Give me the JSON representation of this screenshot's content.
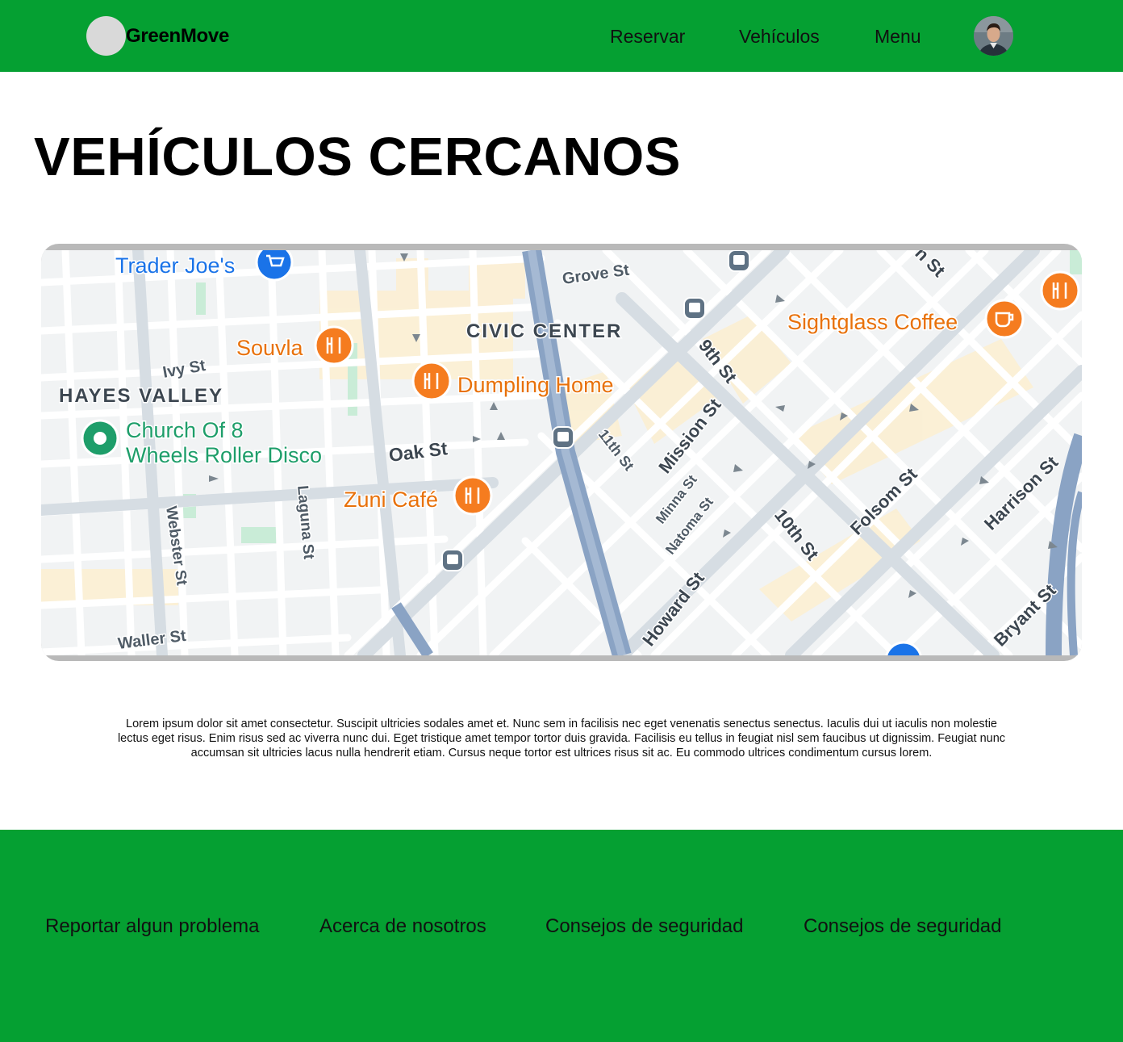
{
  "header": {
    "brand": "GreenMove",
    "nav": [
      {
        "label": "Reservar"
      },
      {
        "label": "Vehículos"
      },
      {
        "label": "Menu"
      }
    ],
    "bg_color": "#05a032"
  },
  "main": {
    "title": "VEHÍCULOS CERCANOS",
    "map": {
      "districts": [
        "CIVIC CENTER",
        "HAYES VALLEY"
      ],
      "places": {
        "trader_joes": "Trader Joe's",
        "souvla": "Souvla",
        "dumpling_home": "Dumpling Home",
        "church_line1": "Church Of 8",
        "church_line2": "Wheels Roller Disco",
        "zuni_cafe": "Zuni Café",
        "sightglass": "Sightglass Coffee"
      },
      "streets": {
        "grove": "Grove St",
        "ivy": "Ivy St",
        "oak": "Oak St",
        "laguna": "Laguna St",
        "webster": "Webster St",
        "waller": "Waller St",
        "ninth": "9th St",
        "mission": "Mission St",
        "eleventh": "11th St",
        "minna": "Minna St",
        "natoma": "Natoma St",
        "tenth": "10th St",
        "howard": "Howard St",
        "folsom": "Folsom St",
        "harrison": "Harrison St",
        "bryant": "Bryant St",
        "eighth_partial": "n St"
      },
      "icons": {
        "cart": "shopping-cart-icon",
        "restaurant": "restaurant-icon",
        "coffee": "coffee-icon",
        "transit": "tram-icon",
        "place": "place-pin-icon"
      }
    },
    "description": "Lorem ipsum dolor sit amet consectetur. Suscipit ultricies sodales amet et. Nunc sem in facilisis nec eget venenatis senectus senectus. Iaculis dui ut iaculis non molestie lectus eget risus. Enim risus sed ac viverra nunc dui. Eget tristique amet tempor tortor duis gravida. Facilisis eu tellus in feugiat nisl sem faucibus ut dignissim. Feugiat nunc accumsan sit ultricies lacus nulla hendrerit etiam. Cursus neque tortor est ultrices risus sit ac. Eu commodo ultrices condimentum cursus lorem."
  },
  "footer": {
    "links": [
      {
        "label": "Reportar algun problema"
      },
      {
        "label": "Acerca de nosotros"
      },
      {
        "label": "Consejos de seguridad"
      },
      {
        "label": "Consejos de seguridad"
      }
    ],
    "bg_color": "#05a032"
  },
  "colors": {
    "brand_green": "#05a032",
    "restaurant_orange": "#f57c1f",
    "shop_blue": "#1a73e8",
    "park_green": "#1e9e6a",
    "highway": "#8aa3c4"
  }
}
